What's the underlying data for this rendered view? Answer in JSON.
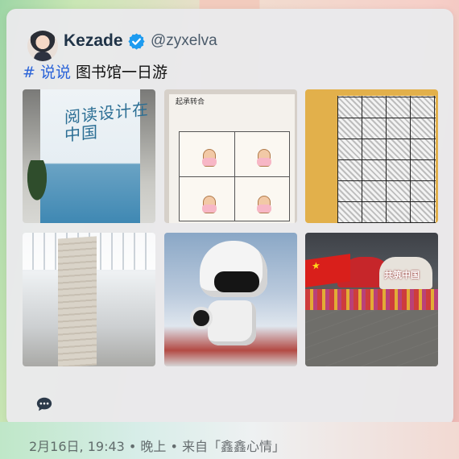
{
  "post": {
    "username": "Kezade",
    "handle": "@zyxelva",
    "hashtag": "# 说说",
    "text": "图书馆一日游"
  },
  "photos": {
    "p1_caption": "阅读设计在中国",
    "p2_caption": "起承转合",
    "p6_caption": "共筑中国"
  },
  "footer": {
    "text": "2月16日, 19:43 • 晚上 • 来自「鑫鑫心情」"
  },
  "colors": {
    "accent": "#2a63d8",
    "verified": "#1d9bf0",
    "username": "#1f3347"
  },
  "icons": {
    "verified": "verified-badge-icon",
    "comment": "comment-bubble-icon"
  }
}
